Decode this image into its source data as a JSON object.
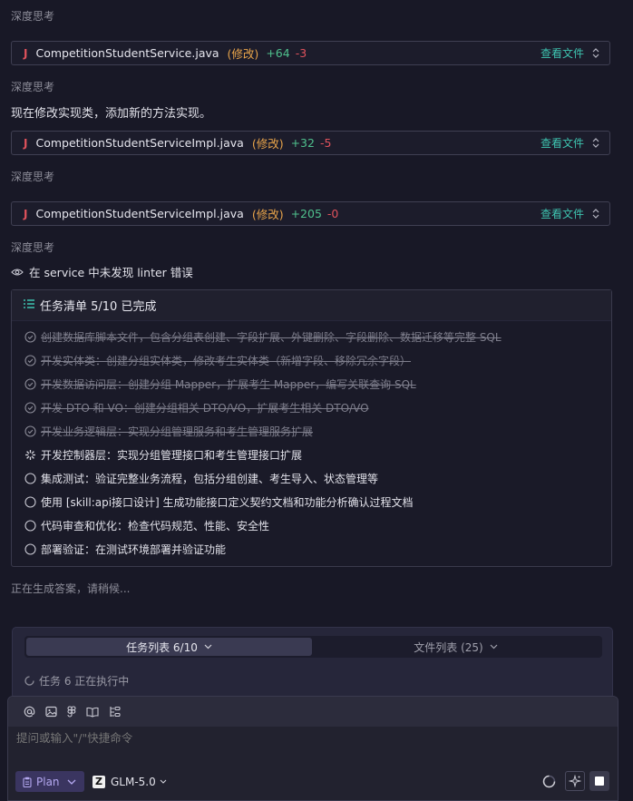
{
  "think_label": "深度思考",
  "message_modify_impl": "现在修改实现类，添加新的方法实现。",
  "file_changes": [
    {
      "icon": "J",
      "name": "CompetitionStudentService.java",
      "status": "(修改)",
      "added": "+64",
      "removed": "-3",
      "view": "查看文件"
    },
    {
      "icon": "J",
      "name": "CompetitionStudentServiceImpl.java",
      "status": "(修改)",
      "added": "+32",
      "removed": "-5",
      "view": "查看文件"
    },
    {
      "icon": "J",
      "name": "CompetitionStudentServiceImpl.java",
      "status": "(修改)",
      "added": "+205",
      "removed": "-0",
      "view": "查看文件"
    }
  ],
  "linter_note": "在 service 中未发现 linter 错误",
  "task_list": {
    "title": "任务清单 5/10 已完成",
    "items": [
      {
        "text": "创建数据库脚本文件，包含分组表创建、字段扩展、外键删除、字段删除、数据迁移等完整 SQL",
        "state": "done"
      },
      {
        "text": "开发实体类：创建分组实体类，修改考生实体类（新增字段、移除冗余字段）",
        "state": "done"
      },
      {
        "text": "开发数据访问层：创建分组 Mapper，扩展考生 Mapper，编写关联查询 SQL",
        "state": "done"
      },
      {
        "text": "开发 DTO 和 VO：创建分组相关 DTO/VO，扩展考生相关 DTO/VO",
        "state": "done"
      },
      {
        "text": "开发业务逻辑层：实现分组管理服务和考生管理服务扩展",
        "state": "done"
      },
      {
        "text": "开发控制器层：实现分组管理接口和考生管理接口扩展",
        "state": "in-progress"
      },
      {
        "text": "集成测试：验证完整业务流程，包括分组创建、考生导入、状态管理等",
        "state": "pending"
      },
      {
        "text": "使用 [skill:api接口设计] 生成功能接口定义契约文档和功能分析确认过程文档",
        "state": "pending"
      },
      {
        "text": "代码审查和优化：检查代码规范、性能、安全性",
        "state": "pending"
      },
      {
        "text": "部署验证：在测试环境部署并验证功能",
        "state": "pending"
      }
    ]
  },
  "generating_status": "正在生成答案，请稍候...",
  "bottom_panel": {
    "tab_tasks": "任务列表 6/10",
    "tab_files": "文件列表 (25)",
    "executing": "任务 6 正在执行中"
  },
  "composer": {
    "placeholder": "提问或输入\"/\"快捷命令",
    "tools": [
      "at-icon",
      "image-icon",
      "figma-icon",
      "book-icon",
      "rules-icon"
    ],
    "mode": "Plan",
    "model_logo": "Z",
    "model": "GLM-5.0"
  },
  "colors": {
    "background": "#181826",
    "accent_teal": "#3ec4b0",
    "modified_orange": "#e8a44a",
    "added_green": "#4fc08d",
    "removed_red": "#e0525c",
    "plan_purple": "#b4a8f0"
  }
}
